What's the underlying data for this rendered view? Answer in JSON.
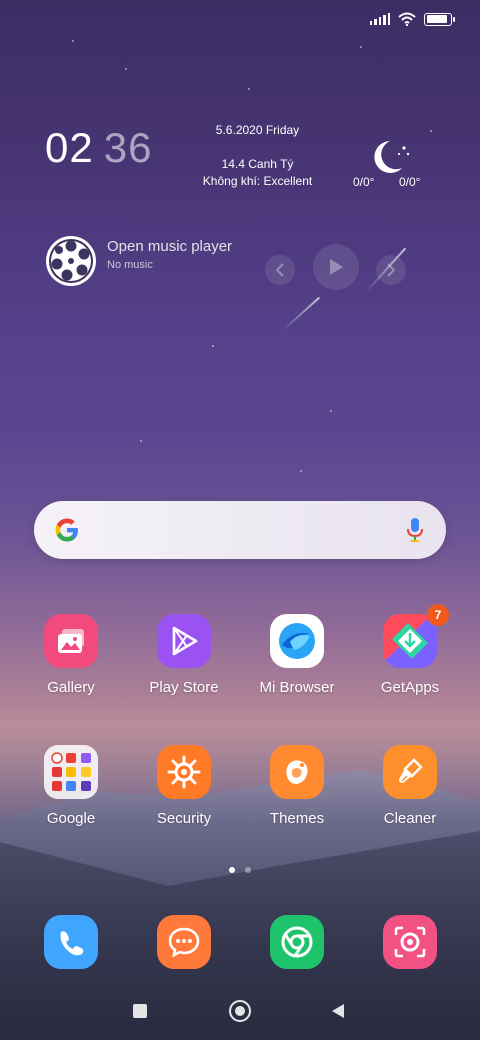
{
  "status_bar": {
    "battery_level": 0.9,
    "icons": [
      "signal-icon",
      "wifi-icon",
      "battery-icon"
    ]
  },
  "clock_widget": {
    "hours": "02",
    "minutes": "36",
    "date": "5.6.2020  Friday",
    "lunar_date": "14.4 Canh Tý",
    "air_quality": "Không khí: Excellent",
    "weather_icon": "moon-stars-icon",
    "temp_low": "0/0°",
    "temp_high": "0/0°"
  },
  "music_widget": {
    "title": "Open music player",
    "subtitle": "No music",
    "controls": [
      "previous-icon",
      "play-icon",
      "next-icon"
    ]
  },
  "search": {
    "icon_left": "google-g-icon",
    "icon_right": "microphone-icon"
  },
  "apps_row1": [
    {
      "label": "Gallery",
      "icon": "gallery-icon",
      "color": "#f04a7e"
    },
    {
      "label": "Play Store",
      "icon": "play-store-icon",
      "color": "#9b52f2"
    },
    {
      "label": "Mi Browser",
      "icon": "mi-browser-icon",
      "color": "#ffffff"
    },
    {
      "label": "GetApps",
      "icon": "getapps-icon",
      "color": "#f7575a",
      "badge": "7"
    }
  ],
  "apps_row2": [
    {
      "label": "Google",
      "icon": "google-folder-icon"
    },
    {
      "label": "Security",
      "icon": "security-icon",
      "color": "#ff7a26"
    },
    {
      "label": "Themes",
      "icon": "themes-icon",
      "color": "#ff8a2f"
    },
    {
      "label": "Cleaner",
      "icon": "cleaner-icon",
      "color": "#ff8f2d"
    }
  ],
  "page_indicator": {
    "pages": 2,
    "current": 1
  },
  "dock": [
    {
      "icon": "phone-icon",
      "color": "#3fa5ff"
    },
    {
      "icon": "messages-icon",
      "color": "#ff7a3a"
    },
    {
      "icon": "chrome-icon",
      "color": "#1fc36c"
    },
    {
      "icon": "camera-icon",
      "color": "#f25283"
    }
  ],
  "nav_bar": [
    "recents-button",
    "home-button",
    "back-button"
  ]
}
